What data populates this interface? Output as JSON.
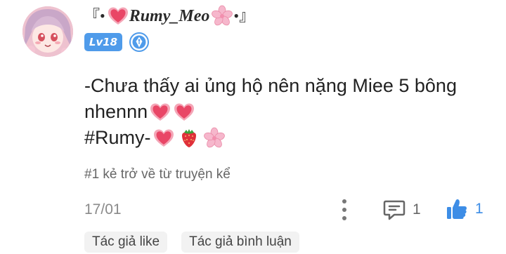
{
  "comment": {
    "author": {
      "name": "Rumy_Meo",
      "name_prefix": "『•",
      "name_suffix": "•』",
      "level_badge": "Lv18",
      "avatar_icon": "anime-avatar",
      "verified_icon": "pen-nib-badge-icon"
    },
    "body": {
      "line1": "-Chưa thấy ai ủng hộ nên nặng Miee 5 bông",
      "line2": "nhennn",
      "line3": "#Rumy-"
    },
    "source": "#1 kẻ trở về từ truyện kể",
    "date": "17/01",
    "actions": {
      "comment_count": "1",
      "like_count": "1"
    },
    "tags": [
      "Tác giả like",
      "Tác giả bình luận"
    ]
  },
  "colors": {
    "accent": "#4f9bea",
    "like": "#3d8de6",
    "heart": "#e94666",
    "sakura": "#f6b7cc"
  }
}
